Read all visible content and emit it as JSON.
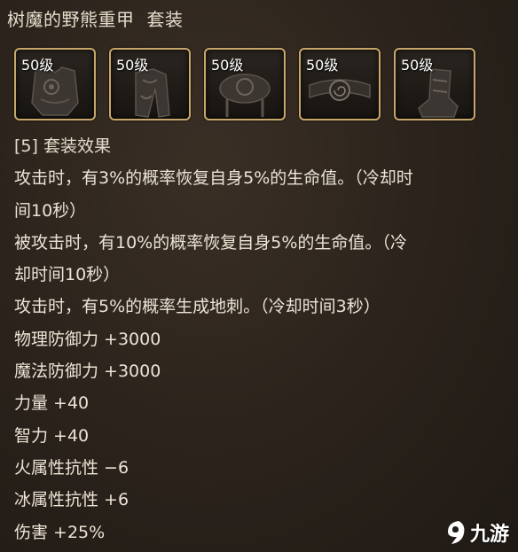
{
  "set": {
    "name": "树魔的野熊重甲",
    "label": "套装"
  },
  "slots": [
    {
      "level": "50级",
      "icon": "chest-armor-icon"
    },
    {
      "level": "50级",
      "icon": "leg-armor-icon"
    },
    {
      "level": "50级",
      "icon": "shoulder-armor-icon"
    },
    {
      "level": "50级",
      "icon": "belt-icon"
    },
    {
      "level": "50级",
      "icon": "boots-icon"
    }
  ],
  "effects": {
    "header": "[5] 套装效果",
    "lines": [
      "攻击时，有3%的概率恢复自身5%的生命值。（冷却时",
      "间10秒）",
      "被攻击时，有10%的概率恢复自身5%的生命值。（冷",
      "却时间10秒）",
      "攻击时，有5%的概率生成地刺。（冷却时间3秒）",
      "物理防御力 +3000",
      "魔法防御力 +3000",
      "力量 +40",
      "智力 +40",
      "火属性抗性 −6",
      "冰属性抗性 +6",
      "伤害 +25%"
    ]
  },
  "watermark": {
    "text": "九游",
    "icon": "jiuyou-logo-icon"
  },
  "colors": {
    "slot_border": "#c8a86a",
    "text": "#ece4d6"
  }
}
